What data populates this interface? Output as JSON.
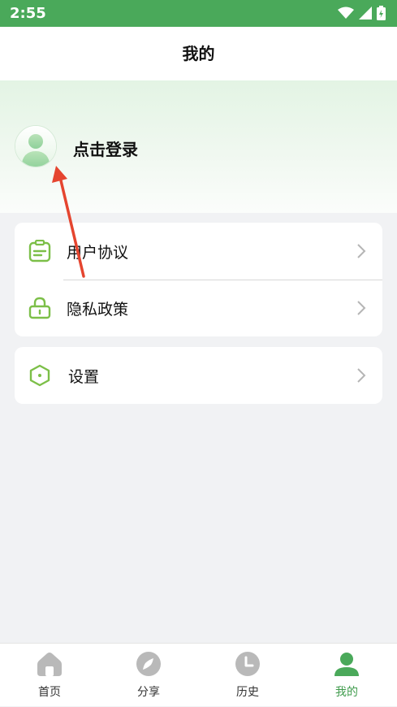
{
  "status_bar": {
    "time": "2:55",
    "icons": [
      "wifi-icon",
      "signal-icon",
      "battery-icon"
    ]
  },
  "header": {
    "title": "我的"
  },
  "profile": {
    "login_label": "点击登录",
    "avatar_icon": "avatar-icon"
  },
  "menu": {
    "group1": [
      {
        "label": "用户协议",
        "icon": "clipboard-icon"
      },
      {
        "label": "隐私政策",
        "icon": "lock-icon"
      }
    ],
    "group2": [
      {
        "label": "设置",
        "icon": "hexagon-settings-icon"
      }
    ]
  },
  "bottom_nav": {
    "items": [
      {
        "label": "首页",
        "icon": "home-icon",
        "active": false
      },
      {
        "label": "分享",
        "icon": "compass-icon",
        "active": false
      },
      {
        "label": "历史",
        "icon": "clock-icon",
        "active": false
      },
      {
        "label": "我的",
        "icon": "user-icon",
        "active": true
      }
    ]
  },
  "colors": {
    "brand_green": "#4aa95a",
    "active_green": "#3f9b4c",
    "icon_green": "#7cbf48",
    "annotation_red": "#e5452f",
    "inactive_icon": "#b9b9b9"
  }
}
